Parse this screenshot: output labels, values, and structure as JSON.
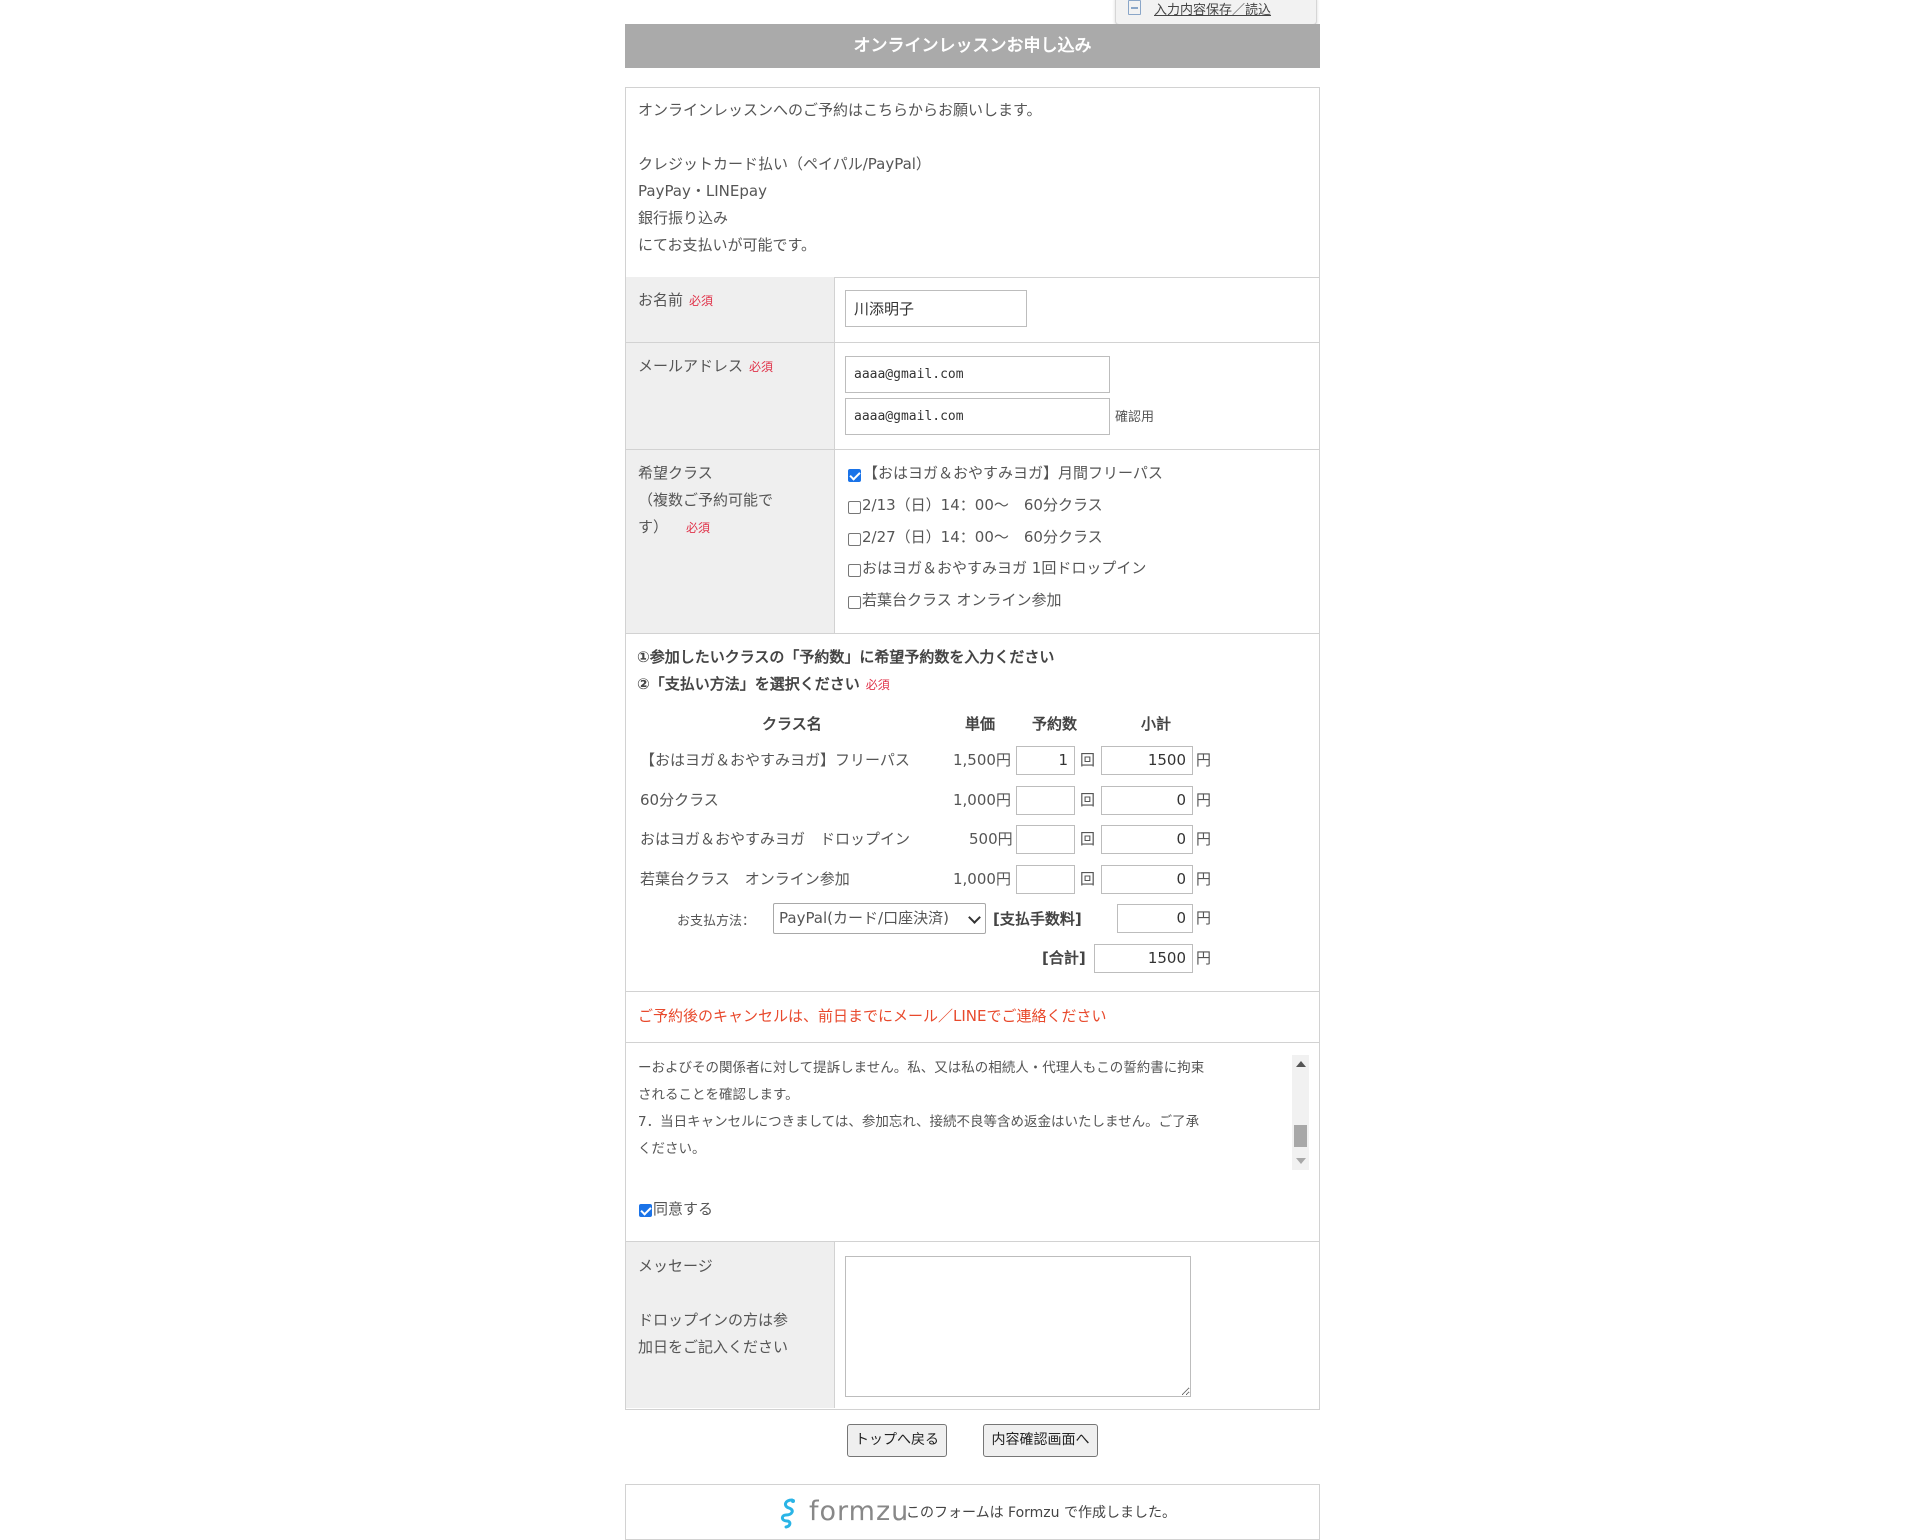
{
  "header": {
    "save_load_label": "入力内容保存／読込",
    "title": "オンラインレッスンお申し込み"
  },
  "intro": {
    "lines": [
      "オンラインレッスンへのご予約はこちらからお願いします。",
      "",
      "クレジットカード払い（ペイパル/PayPal）",
      "PayPay・LINEpay",
      "銀行振り込み",
      "にてお支払いが可能です。"
    ]
  },
  "required_mark": "必須",
  "name_field": {
    "label": "お名前",
    "value": "川添明子"
  },
  "email_field": {
    "label": "メールアドレス",
    "value": "aaaa@gmail.com",
    "confirm_value": "aaaa@gmail.com",
    "confirm_note": "確認用"
  },
  "class_field": {
    "label_line1": "希望クラス",
    "label_line2": "（複数ご予約可能で",
    "label_line3": "す）",
    "options": [
      {
        "label": "【おはヨガ＆おやすみヨガ】月間フリーパス",
        "checked": true
      },
      {
        "label": "2/13（日）14：00〜　60分クラス",
        "checked": false
      },
      {
        "label": "2/27（日）14：00〜　60分クラス",
        "checked": false
      },
      {
        "label": "おはヨガ＆おやすみヨガ 1回ドロップイン",
        "checked": false
      },
      {
        "label": "若葉台クラス オンライン参加",
        "checked": false
      }
    ]
  },
  "order": {
    "instruction1": "①参加したいクラスの「予約数」に希望予約数を入力ください",
    "instruction2": "②「支払い方法」を選択ください",
    "col_name": "クラス名",
    "col_price": "単価",
    "col_qty": "予約数",
    "col_subtotal": "小計",
    "count_unit": "回",
    "yen_unit": "円",
    "rows": [
      {
        "name": "【おはヨガ＆おやすみヨガ】フリーパス",
        "price": "1,500円",
        "qty": "1",
        "subtotal": "1500"
      },
      {
        "name": "60分クラス",
        "price": "1,000円",
        "qty": "",
        "subtotal": "0"
      },
      {
        "name": "おはヨガ＆おやすみヨガ　ドロップイン",
        "price": "500円",
        "qty": "",
        "subtotal": "0"
      },
      {
        "name": "若葉台クラス　オンライン参加",
        "price": "1,000円",
        "qty": "",
        "subtotal": "0"
      }
    ],
    "payment_label": "お支払方法：",
    "payment_value": "PayPal(カード/口座決済)",
    "fee_label": "[支払手数料]",
    "fee_value": "0",
    "total_label": "[合計]",
    "total_value": "1500"
  },
  "cancel_notice": "ご予約後のキャンセルは、前日までにメール／LINEでご連絡ください",
  "terms": {
    "lines": [
      "ーおよびその関係者に対して提訴しません。私、又は私の相続人・代理人もこの誓約書に拘束",
      "されることを確認します。",
      "7．当日キャンセルにつきましては、参加忘れ、接続不良等含め返金はいたしません。ご了承",
      "ください。"
    ],
    "agree_label": "同意する",
    "agree_checked": true
  },
  "message_field": {
    "label": "メッセージ",
    "note_line1": "ドロップインの方は参",
    "note_line2": "加日をご記入ください",
    "value": ""
  },
  "buttons": {
    "back": "トップへ戻る",
    "confirm": "内容確認画面へ"
  },
  "footer": {
    "brand": "formzu",
    "note": "このフォームは Formzu で作成しました。",
    "brand_color": "#2ab4e6"
  }
}
